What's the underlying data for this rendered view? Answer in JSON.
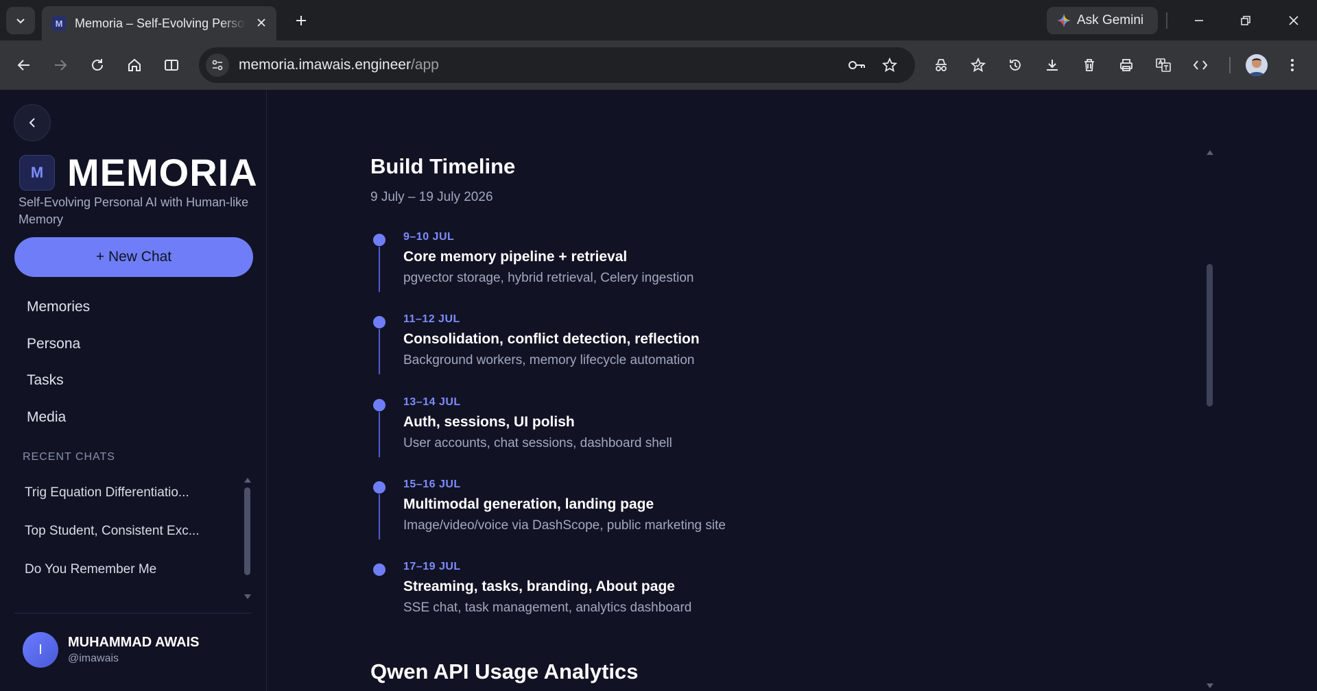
{
  "browser": {
    "tab_title": "Memoria – Self-Evolving Personal AI",
    "favicon_letter": "M",
    "url_host": "memoria.imawais.engineer",
    "url_path": "/app",
    "gemini_label": "Ask Gemini"
  },
  "sidebar": {
    "logo_letter": "M",
    "brand": "MEMORIA",
    "tagline": "Self-Evolving Personal AI with Human-like Memory",
    "new_chat": "+ New Chat",
    "nav": [
      "Memories",
      "Persona",
      "Tasks",
      "Media"
    ],
    "recent_heading": "RECENT CHATS",
    "recent": [
      "Trig Equation Differentiatio...",
      "Top Student, Consistent Exc...",
      "Do You Remember Me"
    ],
    "user": {
      "initial": "I",
      "name": "MUHAMMAD AWAIS",
      "handle": "@imawais"
    }
  },
  "main": {
    "build_title": "Build Timeline",
    "build_range": "9 July – 19 July 2026",
    "timeline": [
      {
        "date": "9–10 JUL",
        "title": "Core memory pipeline + retrieval",
        "desc": "pgvector storage, hybrid retrieval, Celery ingestion"
      },
      {
        "date": "11–12 JUL",
        "title": "Consolidation, conflict detection, reflection",
        "desc": "Background workers, memory lifecycle automation"
      },
      {
        "date": "13–14 JUL",
        "title": "Auth, sessions, UI polish",
        "desc": "User accounts, chat sessions, dashboard shell"
      },
      {
        "date": "15–16 JUL",
        "title": "Multimodal generation, landing page",
        "desc": "Image/video/voice via DashScope, public marketing site"
      },
      {
        "date": "17–19 JUL",
        "title": "Streaming, tasks, branding, About page",
        "desc": "SSE chat, task management, analytics dashboard"
      }
    ],
    "analytics_title": "Qwen API Usage Analytics"
  },
  "colors": {
    "accent": "#6f7ef8",
    "background": "#111324",
    "chrome": "#35363a"
  }
}
